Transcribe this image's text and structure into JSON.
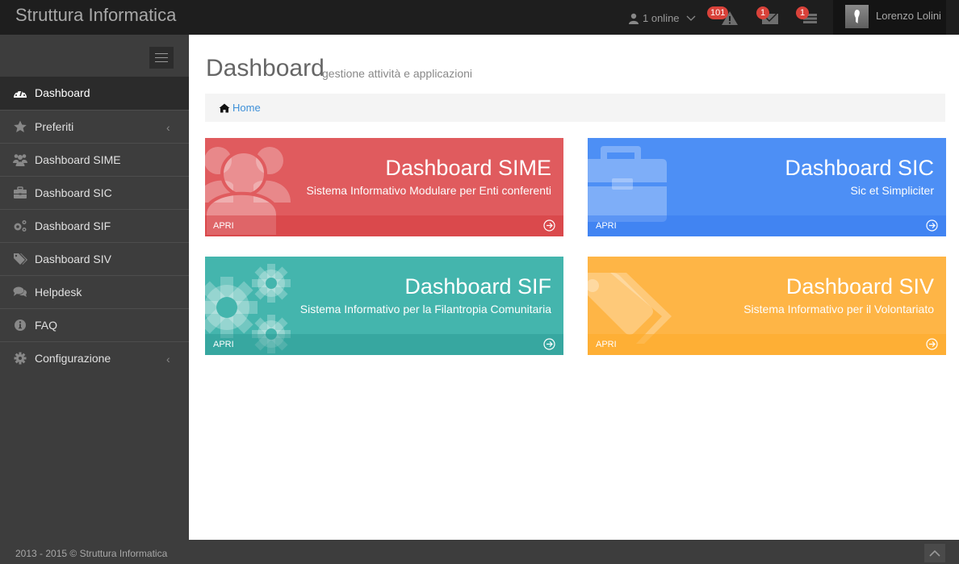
{
  "header": {
    "brand": "Struttura Informatica",
    "online_label": "1 online",
    "notifications": [
      {
        "icon": "warning-icon",
        "count": "101"
      },
      {
        "icon": "envelope-icon",
        "count": "1"
      },
      {
        "icon": "tasks-icon",
        "count": "1"
      }
    ],
    "user_name": "Lorenzo Lolini"
  },
  "sidebar": {
    "items": [
      {
        "label": "Dashboard",
        "icon": "tachometer-icon",
        "active": true
      },
      {
        "label": "Preferiti",
        "icon": "star-icon",
        "has_submenu": true
      },
      {
        "label": "Dashboard SIME",
        "icon": "users-icon"
      },
      {
        "label": "Dashboard SIC",
        "icon": "briefcase-icon"
      },
      {
        "label": "Dashboard SIF",
        "icon": "cogs-icon"
      },
      {
        "label": "Dashboard SIV",
        "icon": "tags-icon"
      },
      {
        "label": "Helpdesk",
        "icon": "comments-icon"
      },
      {
        "label": "FAQ",
        "icon": "info-icon"
      },
      {
        "label": "Configurazione",
        "icon": "gear-icon",
        "has_submenu": true
      }
    ],
    "chevron": "‹"
  },
  "main": {
    "title": "Dashboard",
    "subtitle": "gestione attività e applicazioni",
    "breadcrumb": {
      "home": "Home"
    },
    "tiles": [
      {
        "title": "Dashboard SIME",
        "subtitle": "Sistema Informativo Modulare per Enti conferenti",
        "footer": "APRI",
        "color": "#e05b5e",
        "footer_color": "#dc4c4f",
        "icon": "users-icon"
      },
      {
        "title": "Dashboard SIC",
        "subtitle": "Sic et Simpliciter",
        "footer": "APRI",
        "color": "#4d8ff5",
        "footer_color": "#4285f4",
        "icon": "briefcase-icon"
      },
      {
        "title": "Dashboard SIF",
        "subtitle": "Sistema Informativo per la Filantropia Comunitaria",
        "footer": "APRI",
        "color": "#44b5ad",
        "footer_color": "#3faaa3",
        "icon": "cogs-icon"
      },
      {
        "title": "Dashboard SIV",
        "subtitle": "Sistema Informativo per il Volontariato",
        "footer": "APRI",
        "color": "#feb546",
        "footer_color": "#fdae38",
        "icon": "tags-icon"
      }
    ]
  },
  "footer": {
    "copyright": "2013 - 2015 © Struttura Informatica"
  }
}
